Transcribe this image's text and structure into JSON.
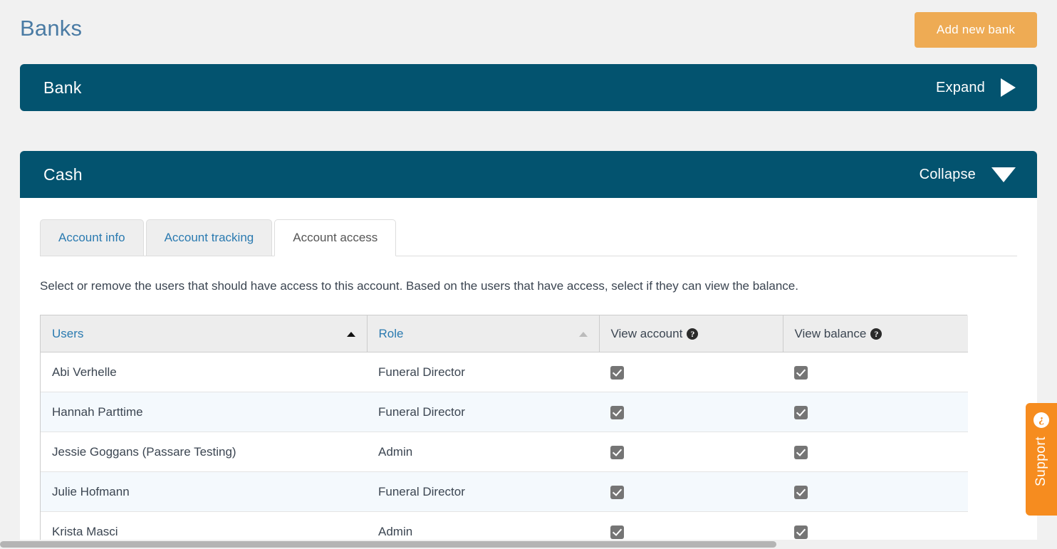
{
  "page": {
    "title": "Banks",
    "add_button_label": "Add new bank"
  },
  "panels": [
    {
      "name": "Bank",
      "toggle_label": "Expand",
      "toggle_icon": "triangle-right-icon",
      "expanded": false
    },
    {
      "name": "Cash",
      "toggle_label": "Collapse",
      "toggle_icon": "triangle-down-icon",
      "expanded": true
    }
  ],
  "tabs": [
    {
      "label": "Account info",
      "active": false
    },
    {
      "label": "Account tracking",
      "active": false
    },
    {
      "label": "Account access",
      "active": true
    }
  ],
  "description": "Select or remove the users that should have access to this account. Based on the users that have access, select if they can view the balance.",
  "table": {
    "columns": [
      {
        "label": "Users",
        "sortable": true,
        "sort": "asc",
        "sort_active": true
      },
      {
        "label": "Role",
        "sortable": true,
        "sort": "asc",
        "sort_active": false
      },
      {
        "label": "View account",
        "sortable": false,
        "help": "?"
      },
      {
        "label": "View balance",
        "sortable": false,
        "help": "?"
      }
    ],
    "rows": [
      {
        "user": "Abi Verhelle",
        "role": "Funeral Director",
        "view_account": true,
        "view_balance": true
      },
      {
        "user": "Hannah Parttime",
        "role": "Funeral Director",
        "view_account": true,
        "view_balance": true
      },
      {
        "user": "Jessie Goggans (Passare Testing)",
        "role": "Admin",
        "view_account": true,
        "view_balance": true
      },
      {
        "user": "Julie Hofmann",
        "role": "Funeral Director",
        "view_account": true,
        "view_balance": true
      },
      {
        "user": "Krista Masci",
        "role": "Admin",
        "view_account": true,
        "view_balance": true
      }
    ]
  },
  "support": {
    "label": "Support",
    "icon": "question-circle-icon"
  },
  "colors": {
    "panel_header": "#03536f",
    "accent_orange": "#eeab54",
    "support_orange": "#f68c1f",
    "link_blue": "#2a7ab0",
    "title_blue": "#4a7ba4",
    "page_bg": "#f1f1f1"
  }
}
